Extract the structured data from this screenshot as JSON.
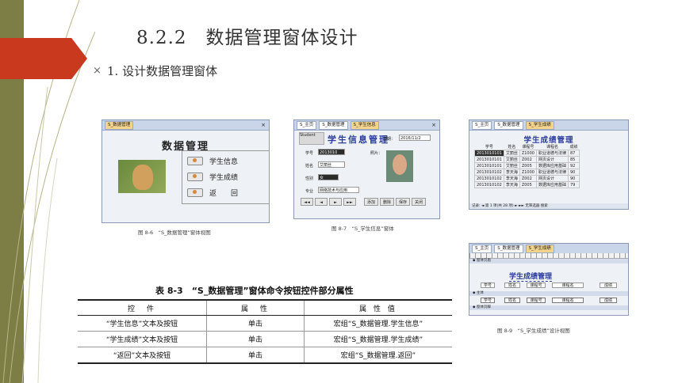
{
  "slide": {
    "title": "8.2.2　数据管理窗体设计",
    "bullet_marker": "×",
    "bullet": "1. 设计数据管理窗体",
    "accent_color": "#c8391d",
    "deco_color": "#7d7d46"
  },
  "fig1": {
    "tab": "S_数据管理",
    "close": "×",
    "heading": "数据管理",
    "buttons": [
      "学生信息",
      "学生成绩",
      "返　　回"
    ],
    "caption": "图 8-6　“S_数据管理”窗体视图"
  },
  "fig2": {
    "tabs": [
      "S_主页",
      "S_数据管理",
      "S_学生信息"
    ],
    "close": "×",
    "logo": "Student",
    "heading": "学生信息管理",
    "date_label": "日期：",
    "date_value": "2016/11/2",
    "fields": [
      {
        "label": "学号",
        "value": "2013010"
      },
      {
        "label": "姓名",
        "value": "艾丽丝"
      },
      {
        "label": "性别",
        "value": "女"
      },
      {
        "label": "专业",
        "value": "网络技术与应用"
      }
    ],
    "photo_label": "照片：",
    "nav_buttons": [
      "◄◄",
      "◄",
      "►",
      "►►",
      "添加",
      "删除",
      "保存",
      "关闭"
    ],
    "caption": "图 8-7　“S_学生信息”窗体"
  },
  "fig3": {
    "tabs": [
      "S_主页",
      "S_数据管理",
      "S_学生成绩"
    ],
    "heading": "学生成绩管理",
    "columns": [
      "学号",
      "姓名",
      "课程号",
      "课程名",
      "成绩"
    ],
    "rows": [
      [
        "2013010101",
        "艾丽丝",
        "Z1000",
        "职业道德与法律",
        "87"
      ],
      [
        "2013010101",
        "艾丽丝",
        "Z002",
        "网页设计",
        "85"
      ],
      [
        "2013010101",
        "艾丽丝",
        "Z005",
        "数据库应用基础",
        "92"
      ],
      [
        "2013010102",
        "李天海",
        "Z1000",
        "职业道德与法律",
        "90"
      ],
      [
        "2013010102",
        "李天海",
        "Z002",
        "网页设计",
        "90"
      ],
      [
        "2013010102",
        "李天海",
        "Z005",
        "数据库应用基础",
        "79"
      ]
    ],
    "status": "记录: ◄ 第 1 项(共 28 项) ► ►► 无筛选器 搜索"
  },
  "fig4": {
    "tabs": [
      "S_主页",
      "S_数据管理",
      "S_学生成绩"
    ],
    "band_header": "◆ 窗体页眉",
    "band_detail": "◆ 主体",
    "band_footer": "◆ 窗体页脚",
    "heading": "学生成绩管理",
    "labels": [
      "学号",
      "姓名",
      "课程号",
      "课程名",
      "成绩"
    ],
    "fields": [
      "学号",
      "姓名",
      "课程号",
      "课程名",
      "成绩"
    ],
    "caption": "图 8-9　“S_学生成绩”设计视图"
  },
  "table": {
    "title": "表 8-3　“S_数据管理”窗体命令按钮控件部分属性",
    "headers": [
      "控　件",
      "属　性",
      "属 性 值"
    ],
    "rows": [
      [
        "“学生信息”文本及按钮",
        "单击",
        "宏组“S_数据管理.学生信息”"
      ],
      [
        "“学生成绩”文本及按钮",
        "单击",
        "宏组“S_数据管理.学生成绩”"
      ],
      [
        "“返回”文本及按钮",
        "单击",
        "宏组“S_数据管理.返回”"
      ]
    ]
  }
}
